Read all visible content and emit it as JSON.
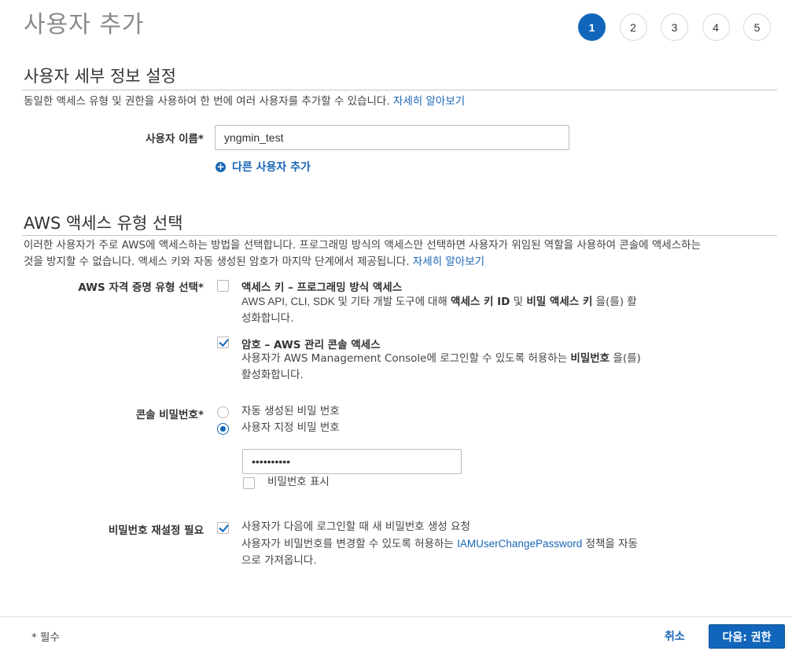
{
  "header": {
    "title": "사용자 추가",
    "steps": [
      "1",
      "2",
      "3",
      "4",
      "5"
    ],
    "active_step": "1"
  },
  "details": {
    "title": "사용자 세부 정보 설정",
    "description": "동일한 액세스 유형 및 권한을 사용하여 한 번에 여러 사용자를 추가할 수 있습니다.",
    "learn_more": "자세히 알아보기",
    "username_label": "사용자 이름*",
    "username_value": "yngmin_test",
    "add_user_label": "다른 사용자 추가"
  },
  "access": {
    "title": "AWS 액세스 유형 선택",
    "description_1": "이러한 사용자가 주로 AWS에 액세스하는 방법을 선택합니다. 프로그래밍 방식의 액세스만 선택하면 사용자가 위임된 역할을 사용하여 콘솔에 액세스하는",
    "description_2": "것을 방지할 수 없습니다. 액세스 키와 자동 생성된 암호가 마지막 단계에서 제공됩니다.",
    "learn_more": "자세히 알아보기",
    "credential_label": "AWS 자격 증명 유형 선택*",
    "programmatic": {
      "title": "액세스 키 – 프로그래밍 방식 액세스",
      "text_1": "AWS API, CLI, SDK 및 기타 개발 도구에 대해",
      "bold_1": "액세스 키 ID",
      "text_2": "및",
      "bold_2": "비밀 액세스 키",
      "text_3": "을(를) 활",
      "text_4": "성화합니다.",
      "checked": false
    },
    "console": {
      "title": "암호 – AWS 관리 콘솔 액세스",
      "text_1": "사용자가 AWS Management Console에 로그인할 수 있도록 허용하는",
      "bold_1": "비밀번호",
      "text_2": "을(를)",
      "text_3": "활성화합니다.",
      "checked": true
    },
    "console_password_label": "콘솔 비밀번호*",
    "auto_password_label": "자동 생성된 비밀 번호",
    "custom_password_label": "사용자 지정 비밀 번호",
    "selected_password_option": "custom",
    "password_value": "••••••••••",
    "show_password_label": "비밀번호 표시",
    "reset_label": "비밀번호 재설정 필요",
    "reset_text_1": "사용자가 다음에 로그인할 때 새 비밀번호 생성 요청",
    "reset_text_2": "사용자가 비밀번호를 변경할 수 있도록 허용하는",
    "reset_policy_link": "IAMUserChangePassword",
    "reset_text_3": "정책을 자동",
    "reset_text_4": "으로 가져옵니다.",
    "reset_checked": true
  },
  "footer": {
    "required_note": "* 필수",
    "cancel_label": "취소",
    "next_label": "다음: 권한"
  },
  "colors": {
    "primary": "#1166bb",
    "link": "#1a66b8"
  }
}
